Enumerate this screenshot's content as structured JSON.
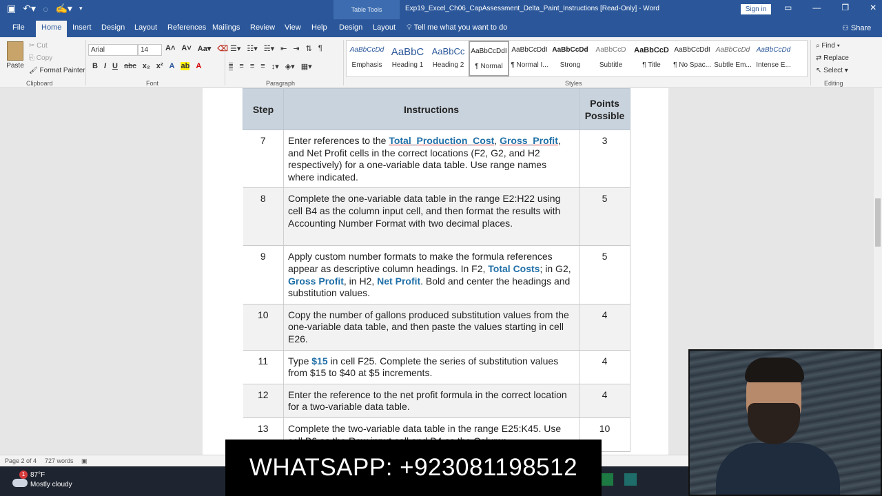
{
  "window": {
    "table_tools": "Table Tools",
    "title": "Exp19_Excel_Ch06_CapAssessment_Delta_Paint_Instructions [Read-Only]  -  Word",
    "sign_in": "Sign in"
  },
  "tabs": [
    "File",
    "Home",
    "Insert",
    "Design",
    "Layout",
    "References",
    "Mailings",
    "Review",
    "View",
    "Help",
    "Design",
    "Layout"
  ],
  "tell_me": "Tell me what you want to do",
  "share": "Share",
  "clipboard": {
    "paste": "Paste",
    "cut": "Cut",
    "copy": "Copy",
    "format_painter": "Format Painter",
    "label": "Clipboard"
  },
  "font": {
    "name": "Arial",
    "size": "14",
    "label": "Font"
  },
  "paragraph_label": "Paragraph",
  "styles": {
    "label": "Styles",
    "items": [
      {
        "preview": "AaBbCcDd",
        "name": "Emphasis"
      },
      {
        "preview": "AaBbC",
        "name": "Heading 1"
      },
      {
        "preview": "AaBbCc",
        "name": "Heading 2"
      },
      {
        "preview": "AaBbCcDdI",
        "name": "¶ Normal"
      },
      {
        "preview": "AaBbCcDdI",
        "name": "¶ Normal I..."
      },
      {
        "preview": "AaBbCcDd",
        "name": "Strong"
      },
      {
        "preview": "AaBbCcD",
        "name": "Subtitle"
      },
      {
        "preview": "AaBbCcD",
        "name": "¶ Title"
      },
      {
        "preview": "AaBbCcDdI",
        "name": "¶ No Spac..."
      },
      {
        "preview": "AaBbCcDd",
        "name": "Subtle Em..."
      },
      {
        "preview": "AaBbCcDd",
        "name": "Intense E..."
      }
    ]
  },
  "editing": {
    "find": "Find",
    "replace": "Replace",
    "select": "Select",
    "label": "Editing"
  },
  "table": {
    "headers": {
      "step": "Step",
      "instructions": "Instructions",
      "points": "Points Possible"
    },
    "rows": [
      {
        "step": "7",
        "points": "3",
        "parts": [
          "Enter references to the ",
          "Total_Production_Cost",
          ", ",
          "Gross_Profit",
          ", and Net Profit cells in the correct locations (F2, G2, and H2 respectively) for a one-variable data table. Use range names where indicated."
        ]
      },
      {
        "step": "8",
        "points": "5",
        "text": "Complete the one-variable data table in the range E2:H22 using cell B4 as the column input cell, and then format the results with Accounting Number Format with two decimal places."
      },
      {
        "step": "9",
        "points": "5",
        "parts": [
          "Apply custom number formats to make the formula references appear as descriptive column headings. In F2, ",
          "Total Costs",
          "; in G2, ",
          "Gross Profit",
          ", in H2, ",
          "Net Profit",
          ". Bold and center the headings and substitution values."
        ]
      },
      {
        "step": "10",
        "points": "4",
        "text": "Copy the number of gallons produced substitution values from the one-variable data table, and then paste the values starting in cell E26."
      },
      {
        "step": "11",
        "points": "4",
        "parts": [
          "Type ",
          "$15",
          " in cell F25. Complete the series of substitution values from $15 to $40 at $5 increments."
        ]
      },
      {
        "step": "12",
        "points": "4",
        "text": "Enter the reference to the net profit formula in the correct location for a two-variable data table."
      },
      {
        "step": "13",
        "points": "10",
        "text": "Complete the two-variable data table in the range E25:K45. Use cell B6 as the Row input cell and B4 as the Column"
      }
    ]
  },
  "status": {
    "page": "Page 2 of 4",
    "words": "727 words"
  },
  "weather": {
    "badge": "1",
    "temp": "87°F",
    "condition": "Mostly cloudy"
  },
  "banner": "WHATSAPP: +923081198512"
}
